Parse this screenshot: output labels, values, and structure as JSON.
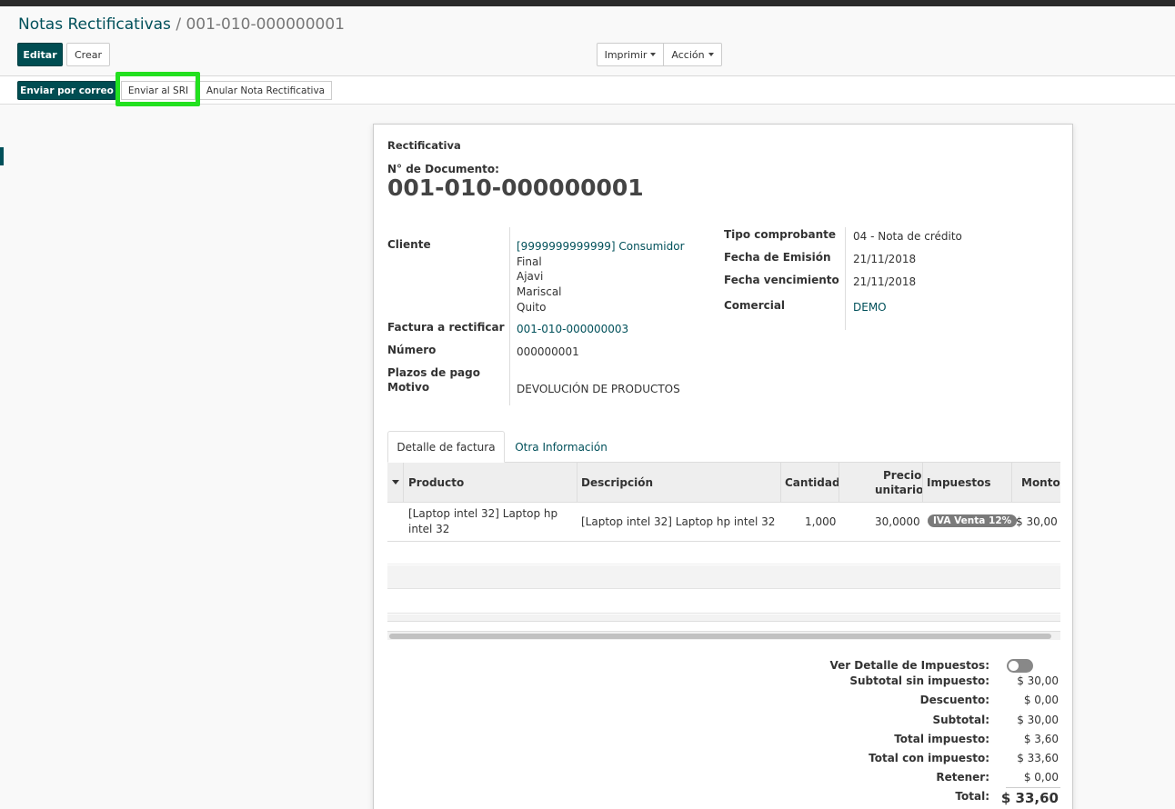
{
  "breadcrumb": {
    "parent": "Notas Rectificativas",
    "separator": "/",
    "current": "001-010-000000001"
  },
  "buttons": {
    "edit": "Editar",
    "create": "Crear",
    "print": "Imprimir",
    "action": "Acción"
  },
  "header_buttons": {
    "send_email": "Enviar por correo",
    "send_sri": "Enviar al SRI",
    "cancel_note": "Anular Nota Rectificativa"
  },
  "form": {
    "doc_type_title": "Rectificativa",
    "doc_number_label": "N° de Documento:",
    "doc_number": "001-010-000000001",
    "left_fields": {
      "cliente_label": "Cliente",
      "cliente_lines": [
        "[9999999999999] Consumidor",
        "Final",
        "Ajavi",
        "Mariscal",
        "Quito"
      ],
      "factura_label": "Factura a rectificar",
      "factura_value": "001-010-000000003",
      "numero_label": "Número",
      "numero_value": "000000001",
      "plazos_label": "Plazos de pago",
      "motivo_label": "Motivo",
      "motivo_value": "DEVOLUCIÓN DE PRODUCTOS"
    },
    "right_fields": {
      "tipo_label": "Tipo comprobante",
      "tipo_value": "04 - Nota de crédito",
      "emision_label": "Fecha de Emisión",
      "emision_value": "21/11/2018",
      "vencimiento_label": "Fecha vencimiento",
      "vencimiento_value": "21/11/2018",
      "comercial_label": "Comercial",
      "comercial_value": "DEMO"
    }
  },
  "tabs": [
    {
      "label": "Detalle de factura",
      "active": true
    },
    {
      "label": "Otra Información",
      "active": false
    }
  ],
  "table": {
    "headers": {
      "producto": "Producto",
      "descripcion": "Descripción",
      "cantidad": "Cantidad",
      "precio_line1": "Precio",
      "precio_line2": "unitario",
      "impuestos": "Impuestos",
      "monto": "Monto"
    },
    "rows": [
      {
        "producto_line1": "[Laptop intel 32] Laptop hp",
        "producto_line2": "intel 32",
        "descripcion": "[Laptop intel 32] Laptop hp intel 32",
        "cantidad": "1,000",
        "precio": "30,0000",
        "impuesto": "IVA Venta 12%",
        "monto": "$ 30,00"
      }
    ]
  },
  "totals": {
    "ver_detalle_label": "Ver Detalle de Impuestos:",
    "ver_detalle_on": false,
    "subtotal_sin_label": "Subtotal sin impuesto:",
    "subtotal_sin_value": "$ 30,00",
    "descuento_label": "Descuento:",
    "descuento_value": "$ 0,00",
    "subtotal_label": "Subtotal:",
    "subtotal_value": "$ 30,00",
    "total_impuesto_label": "Total impuesto:",
    "total_impuesto_value": "$ 3,60",
    "total_con_label": "Total con impuesto:",
    "total_con_value": "$ 33,60",
    "retener_label": "Retener:",
    "retener_value": "$ 0,00",
    "total_label": "Total:",
    "total_value": "$ 33,60"
  },
  "colors": {
    "brand": "#004d52",
    "link": "#00505a",
    "highlight": "#22e01f",
    "badge": "#7a7a7a"
  }
}
